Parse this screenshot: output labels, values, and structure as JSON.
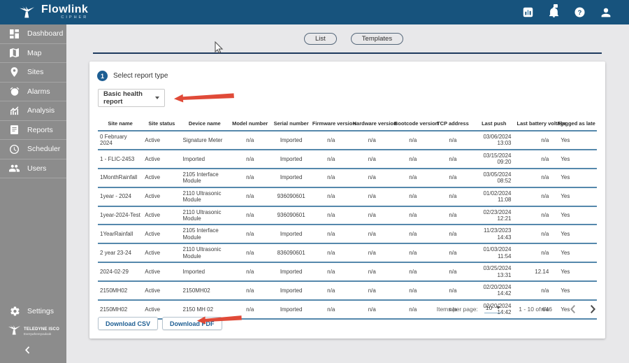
{
  "app": {
    "brand": "Flowlink",
    "brand_sub": "CIPHER"
  },
  "header": {
    "icons": [
      {
        "name": "reports-panel-icon"
      },
      {
        "name": "notifications-bell-icon"
      },
      {
        "name": "help-icon"
      },
      {
        "name": "account-icon"
      }
    ]
  },
  "sidebar": {
    "items": [
      {
        "label": "Dashboard",
        "icon": "dashboard-icon"
      },
      {
        "label": "Map",
        "icon": "map-icon"
      },
      {
        "label": "Sites",
        "icon": "sites-pin-icon"
      },
      {
        "label": "Alarms",
        "icon": "alarm-icon"
      },
      {
        "label": "Analysis",
        "icon": "analysis-icon"
      },
      {
        "label": "Reports",
        "icon": "reports-icon"
      },
      {
        "label": "Scheduler",
        "icon": "scheduler-clock-icon"
      },
      {
        "label": "Users",
        "icon": "users-icon"
      }
    ],
    "settings_label": "Settings",
    "footer_brand": "TELEDYNE ISCO",
    "footer_tagline": "Everywhereyoulook",
    "collapse_icon": "chevron-left-icon"
  },
  "toolbar": {
    "list_label": "List",
    "templates_label": "Templates"
  },
  "report_section": {
    "step_number": "1",
    "step_label": "Select report type",
    "report_type_value": "Basic health report"
  },
  "table": {
    "columns": [
      "Site name",
      "Site status",
      "Device name",
      "Model number",
      "Serial number",
      "Firmware version",
      "Hardware version",
      "Bootcode version",
      "TCP address",
      "Last push",
      "Last battery voltage",
      "Flagged as late"
    ],
    "rows": [
      [
        "0 February 2024",
        "Active",
        "Signature Meter",
        "n/a",
        "Imported",
        "n/a",
        "n/a",
        "n/a",
        "n/a",
        "03/06/2024\n13:03",
        "n/a",
        "Yes"
      ],
      [
        "1 - FLIC-2453",
        "Active",
        "Imported",
        "n/a",
        "Imported",
        "n/a",
        "n/a",
        "n/a",
        "n/a",
        "03/15/2024\n09:20",
        "n/a",
        "Yes"
      ],
      [
        "1MonthRainfall",
        "Active",
        "2105 Interface Module",
        "n/a",
        "Imported",
        "n/a",
        "n/a",
        "n/a",
        "n/a",
        "03/05/2024\n08:52",
        "n/a",
        "Yes"
      ],
      [
        "1year - 2024",
        "Active",
        "2110 Ultrasonic Module",
        "n/a",
        "936090601",
        "n/a",
        "n/a",
        "n/a",
        "n/a",
        "01/02/2024\n11:08",
        "n/a",
        "Yes"
      ],
      [
        "1year-2024-Test",
        "Active",
        "2110 Ultrasonic Module",
        "n/a",
        "936090601",
        "n/a",
        "n/a",
        "n/a",
        "n/a",
        "02/23/2024\n12:21",
        "n/a",
        "Yes"
      ],
      [
        "1YearRainfall",
        "Active",
        "2105 Interface Module",
        "n/a",
        "Imported",
        "n/a",
        "n/a",
        "n/a",
        "n/a",
        "11/23/2023\n14:43",
        "n/a",
        "Yes"
      ],
      [
        "2 year 23-24",
        "Active",
        "2110 Ultrasonic Module",
        "n/a",
        "836090601",
        "n/a",
        "n/a",
        "n/a",
        "n/a",
        "01/03/2024\n11:54",
        "n/a",
        "Yes"
      ],
      [
        "2024-02-29",
        "Active",
        "Imported",
        "n/a",
        "Imported",
        "n/a",
        "n/a",
        "n/a",
        "n/a",
        "03/25/2024\n13:31",
        "12.14",
        "Yes"
      ],
      [
        "2150MH02",
        "Active",
        "2150MH02",
        "n/a",
        "Imported",
        "n/a",
        "n/a",
        "n/a",
        "n/a",
        "02/20/2024\n14:42",
        "n/a",
        "Yes"
      ],
      [
        "2150MH02",
        "Active",
        "2150 MH 02",
        "n/a",
        "Imported",
        "n/a",
        "n/a",
        "n/a",
        "n/a",
        "02/20/2024\n14:42",
        "n/a",
        "Yes"
      ]
    ]
  },
  "pagination": {
    "items_per_page_label": "Items per page:",
    "items_per_page_value": "10",
    "range_label": "1 - 10 of 646"
  },
  "actions": {
    "download_csv_label": "Download CSV",
    "download_pdf_label": "Download PDF"
  },
  "colors": {
    "header_bg": "#17537D",
    "sidebar_bg": "#8C8C8C",
    "accent_blue": "#1D5E93",
    "table_divider": "#5588AC",
    "top_divider": "#1F3A5F",
    "annotation_red": "#E04A38"
  }
}
